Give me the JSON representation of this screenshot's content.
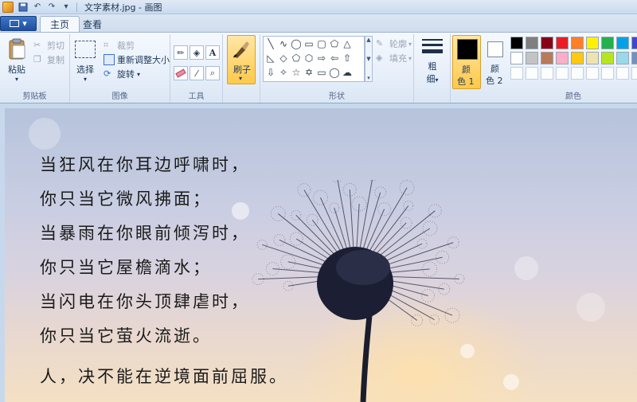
{
  "window": {
    "title": "文字素材.jpg - 画图"
  },
  "tabs": [
    {
      "label": "主页",
      "active": true
    },
    {
      "label": "查看",
      "active": false
    }
  ],
  "clipboard": {
    "paste": "粘贴",
    "cut": "剪切",
    "copy": "复制",
    "group": "剪贴板"
  },
  "image": {
    "select": "选择",
    "crop": "裁剪",
    "resize": "重新调整大小",
    "rotate": "旋转",
    "group": "图像"
  },
  "tools": {
    "group": "工具",
    "brush": "刷子"
  },
  "shapes": {
    "group": "形状",
    "outline": "轮廓",
    "fill": "填充"
  },
  "size": {
    "label1": "粗",
    "label2": "细"
  },
  "colors": {
    "color1_a": "颜",
    "color1_b": "色 1",
    "color2_a": "颜",
    "color2_b": "色 2",
    "group": "颜色",
    "primary": "#000000",
    "secondary": "#ffffff",
    "palette_row1": [
      "#000000",
      "#7f7f7f",
      "#880015",
      "#ed1c24",
      "#ff7f27",
      "#fff200",
      "#22b14c",
      "#00a2e8",
      "#3f48cc",
      "#a349a4"
    ],
    "palette_row2": [
      "#ffffff",
      "#c3c3c3",
      "#b97a57",
      "#ffaec9",
      "#ffc90e",
      "#efe4b0",
      "#b5e61d",
      "#99d9ea",
      "#7092be",
      "#c8bfe7"
    ]
  },
  "canvas": {
    "lines": [
      "当狂风在你耳边呼啸时，",
      "你只当它微风拂面；",
      "当暴雨在你眼前倾泻时，",
      "你只当它屋檐滴水；",
      "当闪电在你头顶肆虐时，",
      "你只当它萤火流逝。",
      "人，决不能在逆境面前屈服。"
    ]
  }
}
